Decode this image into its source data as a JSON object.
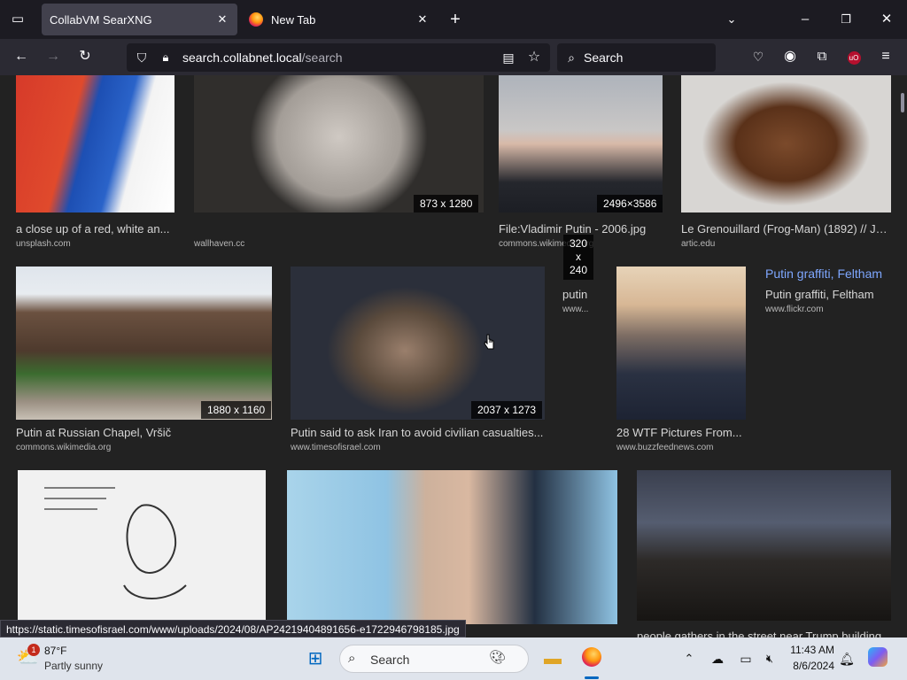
{
  "browser": {
    "tabs": [
      {
        "label": "CollabVM SearXNG",
        "active": true
      },
      {
        "label": "New Tab",
        "active": false
      }
    ],
    "url_host": "search.collabnet.local",
    "url_path": "/search",
    "search_placeholder": "Search"
  },
  "results": {
    "row1": [
      {
        "caption": "a close up of a red, white an...",
        "source": "unsplash.com",
        "dims": ""
      },
      {
        "caption": "",
        "source": "wallhaven.cc",
        "dims": "873 x 1280"
      },
      {
        "caption": "File:Vladimir Putin - 2006.jpg",
        "source": "commons.wikimedia.org",
        "dims": "2496×3586"
      },
      {
        "caption": "Le Grenouillard (Frog-Man) (1892) // Je...",
        "source": "artic.edu",
        "dims": ""
      }
    ],
    "floating_dims": "320\nx\n240",
    "row2": [
      {
        "caption": "Putin at Russian Chapel, Vršič",
        "source": "commons.wikimedia.org",
        "dims": "1880 x 1160"
      },
      {
        "caption": "Putin said to ask Iran to avoid civilian casualties...",
        "source": "www.timesofisrael.com",
        "dims": "2037 x 1273"
      },
      {
        "caption": "putin",
        "source": "www...",
        "dims": ""
      },
      {
        "caption": "28 WTF Pictures From...",
        "source": "www.buzzfeednews.com",
        "dims": ""
      },
      {
        "title_link": "Putin graffiti, Feltham",
        "caption": "Putin graffiti, Feltham",
        "source": "www.flickr.com"
      }
    ],
    "row3": [
      {
        "caption": "",
        "source": ""
      },
      {
        "caption": "",
        "source": ""
      },
      {
        "caption": "people gathers in the street near Trump building...",
        "source": ""
      }
    ]
  },
  "status_url": "https://static.timesofisrael.com/www/uploads/2024/08/AP24219404891656-e1722946798185.jpg",
  "taskbar": {
    "weather_temp": "87°F",
    "weather_desc": "Partly sunny",
    "weather_badge": "1",
    "search_label": "Search",
    "time": "11:43 AM",
    "date": "8/6/2024"
  }
}
